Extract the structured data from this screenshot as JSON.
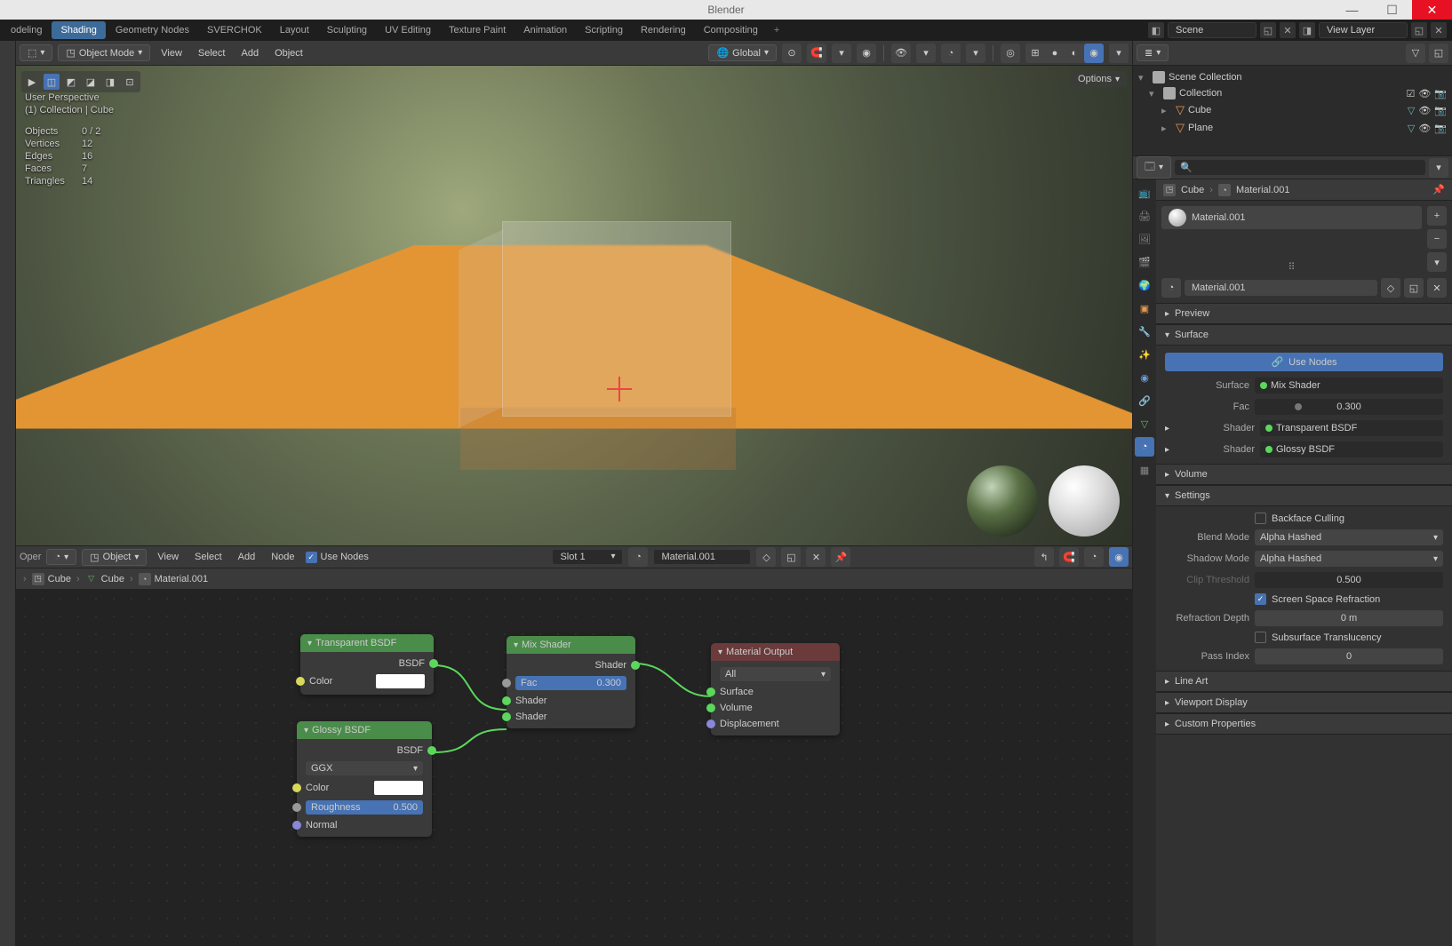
{
  "app_title": "Blender",
  "workspace_tabs": [
    "odeling",
    "Shading",
    "Geometry Nodes",
    "SVERCHOK",
    "Layout",
    "Sculpting",
    "UV Editing",
    "Texture Paint",
    "Animation",
    "Scripting",
    "Rendering",
    "Compositing"
  ],
  "active_ws_idx": 1,
  "scene_name": "Scene",
  "view_layer": "View Layer",
  "viewport_header": {
    "mode": "Object Mode",
    "menus": [
      "View",
      "Select",
      "Add",
      "Object"
    ],
    "orientation": "Global",
    "options_label": "Options"
  },
  "vp_info": {
    "title": "User Perspective",
    "context": "(1) Collection | Cube",
    "stats": [
      {
        "label": "Objects",
        "value": "0 / 2"
      },
      {
        "label": "Vertices",
        "value": "12"
      },
      {
        "label": "Edges",
        "value": "16"
      },
      {
        "label": "Faces",
        "value": "7"
      },
      {
        "label": "Triangles",
        "value": "14"
      }
    ]
  },
  "node_header": {
    "mode_label": "Object",
    "menus": [
      "View",
      "Select",
      "Add",
      "Node"
    ],
    "use_nodes": "Use Nodes",
    "slot": "Slot 1",
    "material": "Material.001"
  },
  "breadcrumb": {
    "obj": "Cube",
    "mesh": "Cube",
    "mat": "Material.001"
  },
  "nodes": {
    "transparent": {
      "title": "Transparent BSDF",
      "out_bsdf": "BSDF",
      "color_label": "Color"
    },
    "glossy": {
      "title": "Glossy BSDF",
      "out_bsdf": "BSDF",
      "distribution": "GGX",
      "color_label": "Color",
      "roughness_label": "Roughness",
      "roughness": "0.500",
      "normal": "Normal"
    },
    "mix": {
      "title": "Mix Shader",
      "out": "Shader",
      "fac_label": "Fac",
      "fac": "0.300",
      "in1": "Shader",
      "in2": "Shader"
    },
    "output": {
      "title": "Material Output",
      "target": "All",
      "surface": "Surface",
      "volume": "Volume",
      "displacement": "Displacement"
    }
  },
  "outliner": {
    "root": "Scene Collection",
    "collection": "Collection",
    "objects": [
      "Cube",
      "Plane"
    ]
  },
  "properties": {
    "obj": "Cube",
    "mat": "Material.001",
    "mat_name": "Material.001",
    "panels": {
      "preview": "Preview",
      "surface": "Surface",
      "volume": "Volume",
      "settings": "Settings",
      "lineart": "Line Art",
      "viewport": "Viewport Display",
      "custom": "Custom Properties"
    },
    "use_nodes": "Use Nodes",
    "surface": {
      "surface_label": "Surface",
      "surface_val": "Mix Shader",
      "fac_label": "Fac",
      "fac_val": "0.300",
      "shader1_label": "Shader",
      "shader1_val": "Transparent BSDF",
      "shader2_label": "Shader",
      "shader2_val": "Glossy BSDF"
    },
    "settings": {
      "backface": "Backface Culling",
      "blend_label": "Blend Mode",
      "blend": "Alpha Hashed",
      "shadow_label": "Shadow Mode",
      "shadow": "Alpha Hashed",
      "clip_label": "Clip Threshold",
      "clip": "0.500",
      "ssr": "Screen Space Refraction",
      "refr_label": "Refraction Depth",
      "refr": "0 m",
      "sst": "Subsurface Translucency",
      "pass_label": "Pass Index",
      "pass": "0"
    }
  }
}
